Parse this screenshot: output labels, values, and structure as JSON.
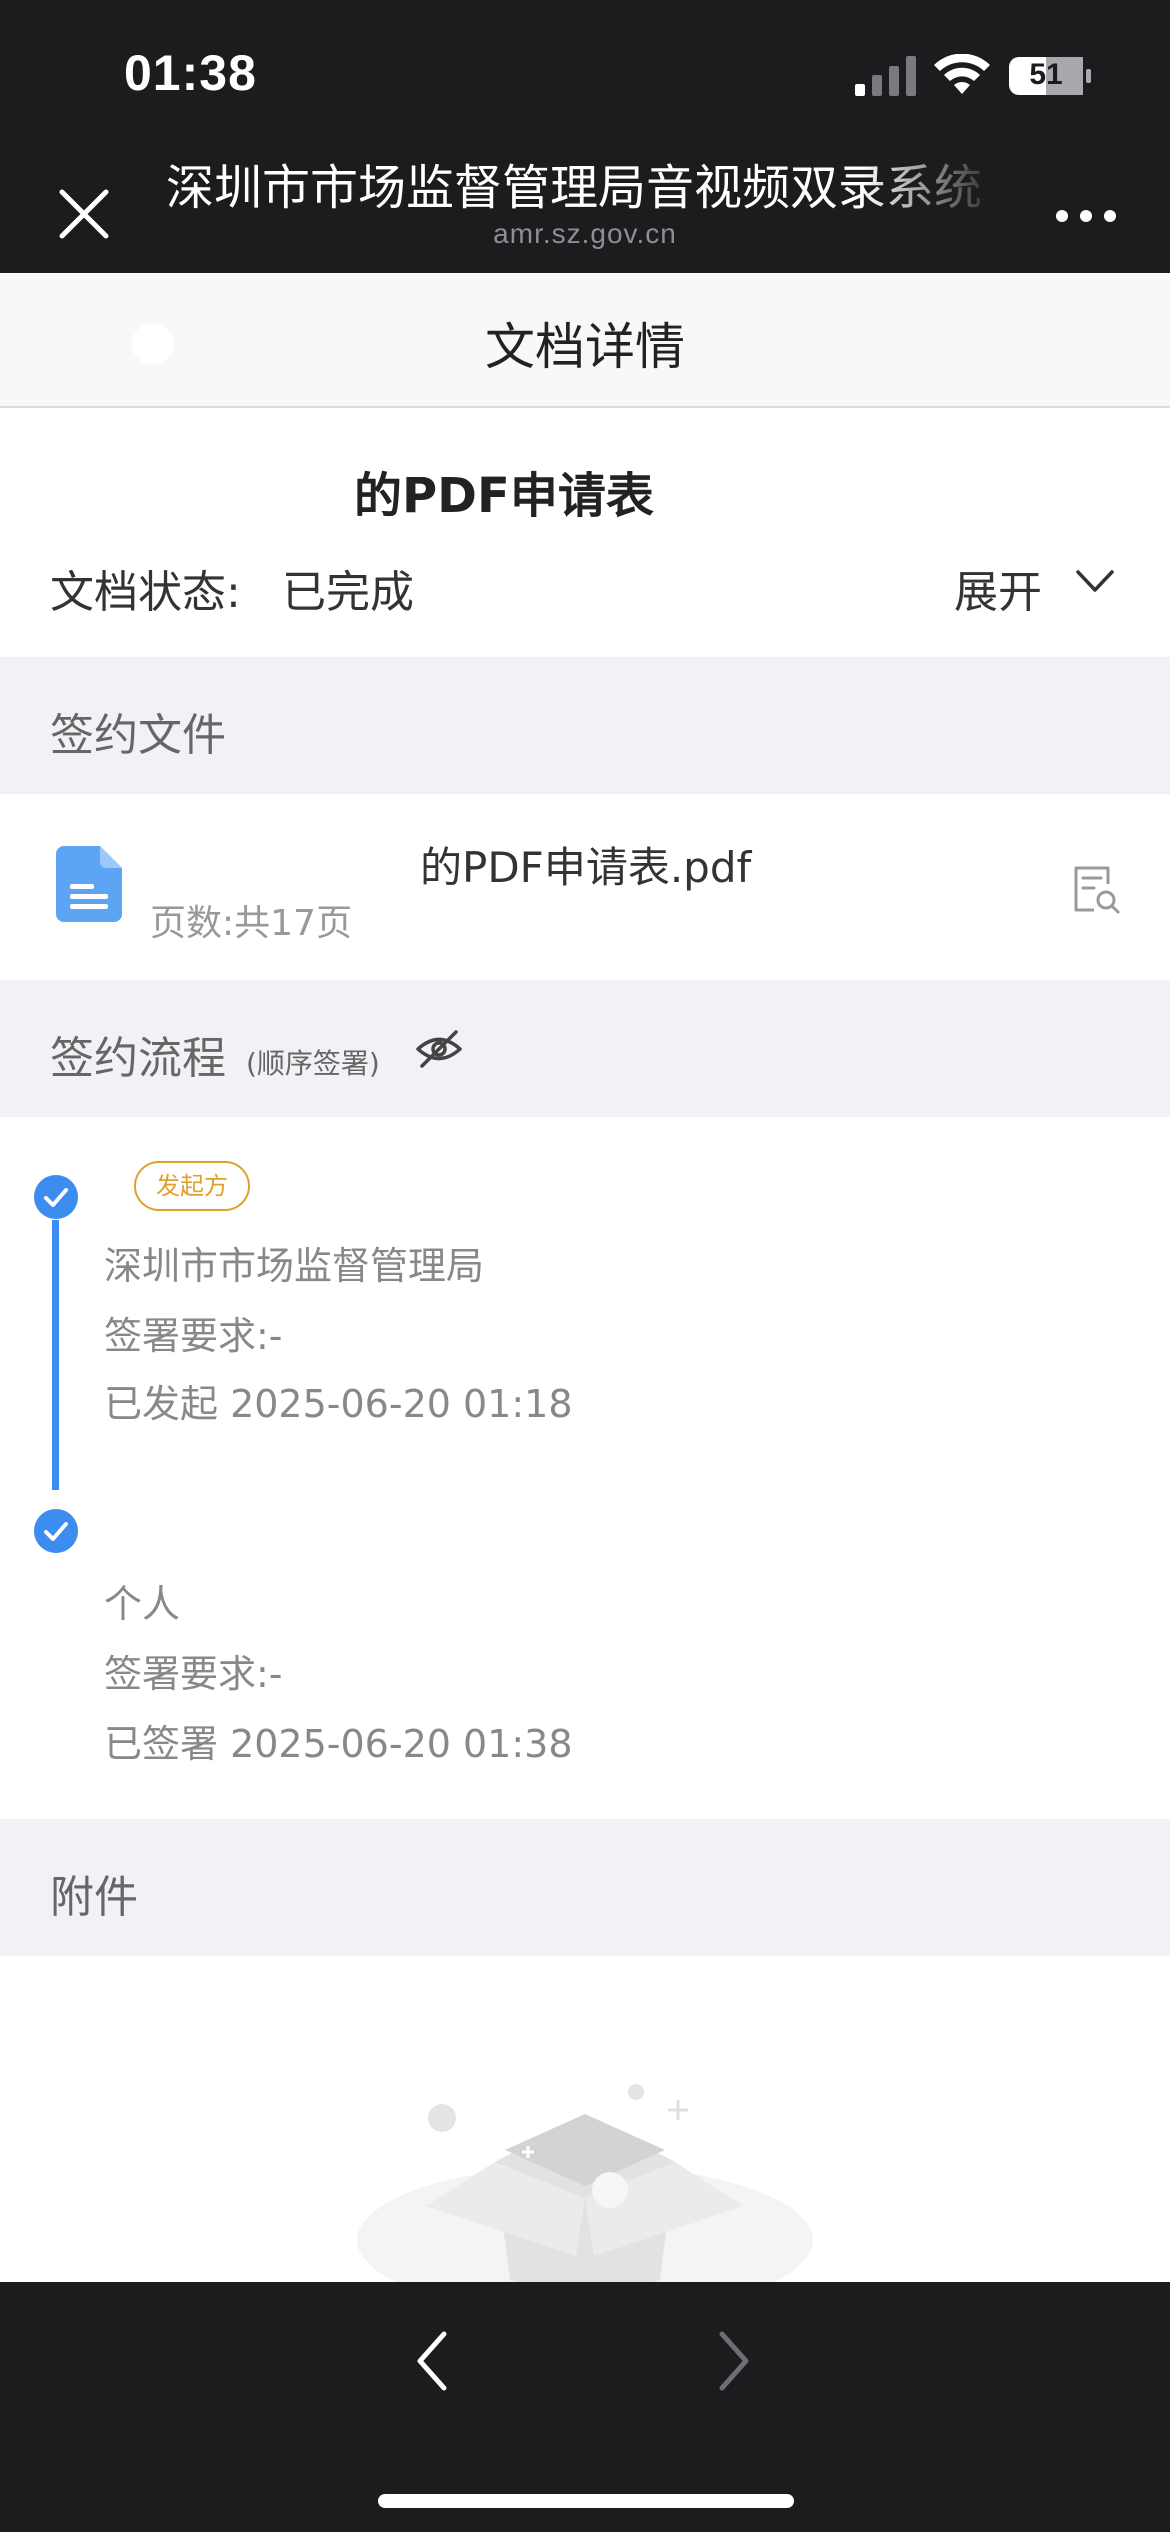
{
  "status_bar": {
    "time": "01:38",
    "battery_level": "51",
    "icons": [
      "signal-icon",
      "wifi-icon",
      "battery-icon"
    ]
  },
  "browser": {
    "title": "深圳市市场监督管理局音视频双录系统",
    "url": "amr.sz.gov.cn",
    "icons": [
      "close-icon",
      "more-icon"
    ]
  },
  "nav": {
    "title": "文档详情",
    "icons": [
      "back-icon"
    ]
  },
  "document": {
    "title": "的PDF申请表",
    "status_label": "文档状态:",
    "status_value": "已完成",
    "expand_label": "展开",
    "icons": [
      "chevron-down-icon"
    ]
  },
  "sections": {
    "files": {
      "label": "签约文件"
    },
    "flow": {
      "label": "签约流程",
      "sub": "(顺序签署)",
      "icon": "eye-off-icon"
    },
    "attachments": {
      "label": "附件"
    }
  },
  "file": {
    "name": "的PDF申请表.pdf",
    "pages": "页数:共17页",
    "icons": [
      "pdf-file-icon",
      "preview-icon"
    ]
  },
  "flow_steps": [
    {
      "tag": "发起方",
      "name": "深圳市市场监督管理局",
      "requirement": "签署要求:-",
      "status": "已发起 2025-06-20 01:18"
    },
    {
      "tag": "",
      "name": "个人",
      "requirement": "签署要求:-",
      "status": "已签署 2025-06-20 01:38"
    }
  ],
  "attachments": {
    "icon": "empty-box-icon"
  },
  "toolbar": {
    "icons": [
      "chevron-left-icon",
      "chevron-right-icon"
    ]
  },
  "colors": {
    "accent": "#3d8cf0",
    "tag": "#e0a030",
    "section_bg": "#f1f2f6",
    "bar_bg": "#1c1c1e"
  }
}
